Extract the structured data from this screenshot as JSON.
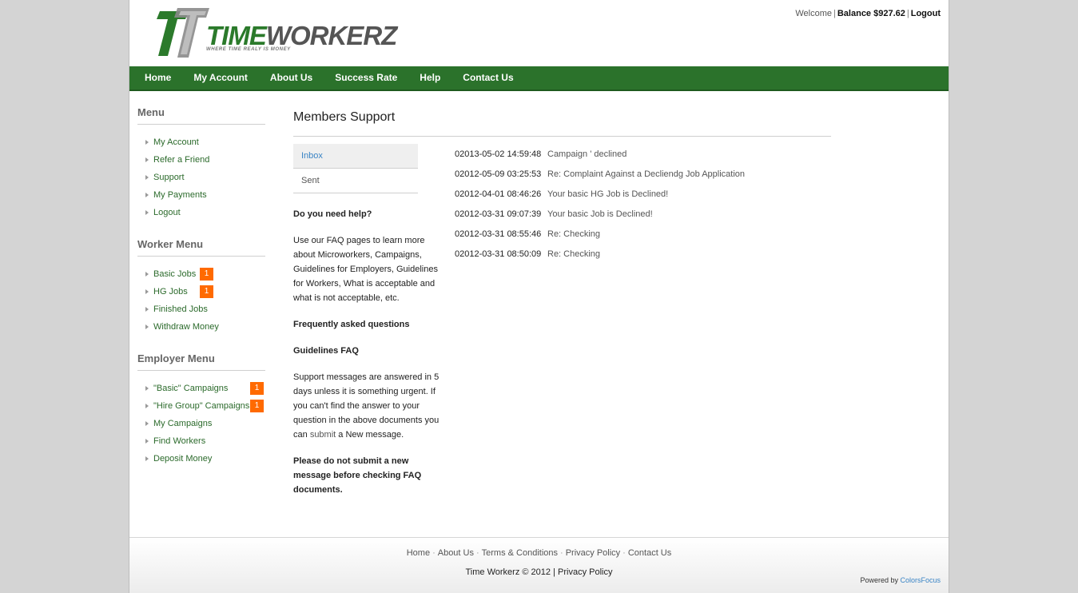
{
  "brand": {
    "logo_word_a": "TIME",
    "logo_word_b": "WORKERZ",
    "tagline": "WHERE TIME REALY IS MONEY",
    "primary_green": "#2b722b",
    "badge_orange": "#ff6a00",
    "link_blue": "#3a84c5"
  },
  "topbar": {
    "welcome": "Welcome",
    "balance": "Balance $927.62",
    "logout": "Logout"
  },
  "nav": [
    "Home",
    "My Account",
    "About Us",
    "Success Rate",
    "Help",
    "Contact Us"
  ],
  "sidebar": {
    "menu": {
      "title": "Menu",
      "items": [
        {
          "label": "My Account"
        },
        {
          "label": "Refer a Friend"
        },
        {
          "label": "Support"
        },
        {
          "label": "My Payments"
        },
        {
          "label": "Logout"
        }
      ]
    },
    "worker_menu": {
      "title": "Worker Menu",
      "items": [
        {
          "label": "Basic Jobs",
          "badge": "1"
        },
        {
          "label": "HG Jobs",
          "badge": "1"
        },
        {
          "label": "Finished Jobs"
        },
        {
          "label": "Withdraw Money"
        }
      ]
    },
    "employer_menu": {
      "title": "Employer Menu",
      "items": [
        {
          "label": "\"Basic\" Campaigns",
          "badge": "1"
        },
        {
          "label": "\"Hire Group\" Campaigns",
          "badge": "1"
        },
        {
          "label": "My Campaigns"
        },
        {
          "label": "Find Workers"
        },
        {
          "label": "Deposit Money"
        }
      ]
    }
  },
  "main": {
    "title": "Members Support",
    "tabs": {
      "inbox": "Inbox",
      "sent": "Sent"
    },
    "help": {
      "heading": "Do you need help?",
      "intro": "Use our FAQ pages to learn more about Microworkers, Campaigns, Guidelines for Employers, Guidelines for Workers, What is acceptable and what is not acceptable, etc.",
      "faq": "Frequently asked questions",
      "guidelines": "Guidelines FAQ",
      "support_text_a": "Support messages are answered in 5 days unless it is something urgent. If you can't find the answer to your question in the above documents you can",
      "submit_link": "submit",
      "support_text_b": "a New message.",
      "warning": "Please do not submit a new message before checking FAQ documents."
    },
    "messages": [
      {
        "date": "02013-05-02 14:59:48",
        "subject": "Campaign ' declined"
      },
      {
        "date": "02012-05-09 03:25:53",
        "subject": "Re: Complaint Against a Decliendg Job Application"
      },
      {
        "date": "02012-04-01 08:46:26",
        "subject": "Your basic HG Job is Declined!"
      },
      {
        "date": "02012-03-31 09:07:39",
        "subject": "Your basic Job is Declined!"
      },
      {
        "date": "02012-03-31 08:55:46",
        "subject": "Re: Checking"
      },
      {
        "date": "02012-03-31 08:50:09",
        "subject": "Re: Checking"
      }
    ]
  },
  "footer": {
    "links": [
      "Home",
      "About Us",
      "Terms & Conditions",
      "Privacy Policy",
      "Contact Us"
    ],
    "copyright": "Time Workerz © 2012",
    "privacy": "Privacy Policy",
    "powered_by": "Powered by",
    "powered_brand": "ColorsFocus"
  }
}
